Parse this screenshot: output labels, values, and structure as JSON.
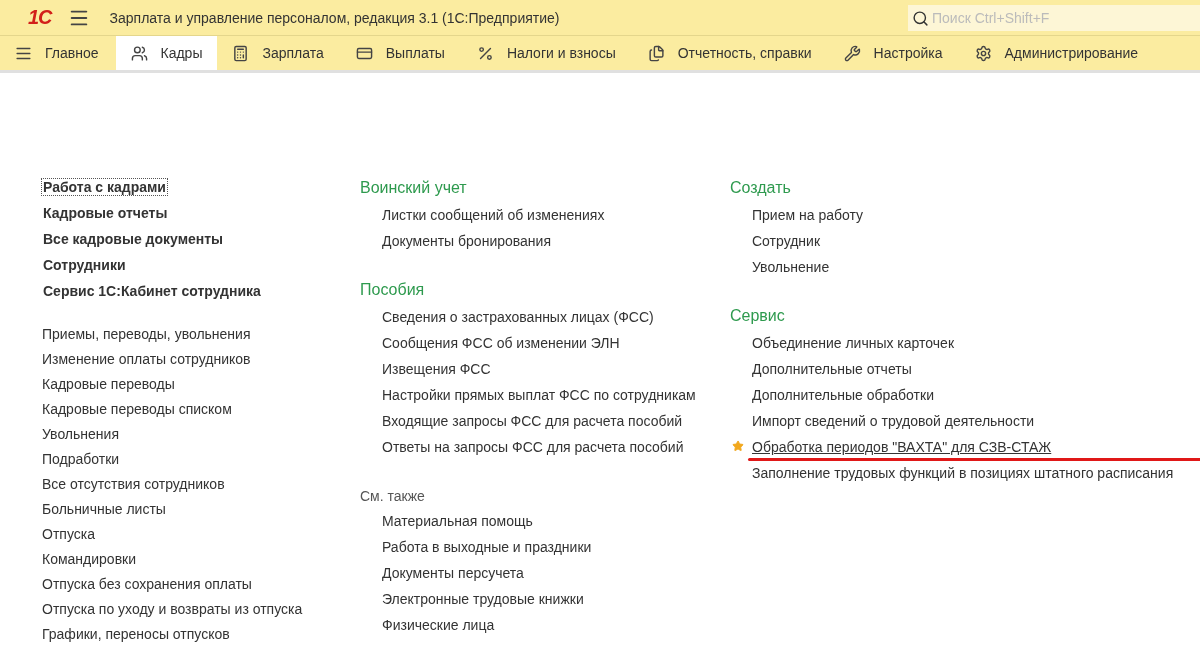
{
  "header": {
    "logo": "1С",
    "title": "Зарплата и управление персоналом, редакция 3.1  (1С:Предприятие)"
  },
  "search": {
    "placeholder": "Поиск Ctrl+Shift+F"
  },
  "sections": [
    {
      "label": "Главное",
      "selected": false
    },
    {
      "label": "Кадры",
      "selected": true
    },
    {
      "label": "Зарплата",
      "selected": false
    },
    {
      "label": "Выплаты",
      "selected": false
    },
    {
      "label": "Налоги и взносы",
      "selected": false
    },
    {
      "label": "Отчетность, справки",
      "selected": false
    },
    {
      "label": "Настройка",
      "selected": false
    },
    {
      "label": "Администрирование",
      "selected": false
    }
  ],
  "left": {
    "primary": [
      {
        "label": "Работа с кадрами",
        "focused": true
      },
      {
        "label": "Кадровые отчеты",
        "focused": false
      },
      {
        "label": "Все кадровые документы",
        "focused": false
      },
      {
        "label": "Сотрудники",
        "focused": false
      },
      {
        "label": "Сервис 1С:Кабинет сотрудника",
        "focused": false
      }
    ],
    "secondary": [
      "Приемы, переводы, увольнения",
      "Изменение оплаты сотрудников",
      "Кадровые переводы",
      "Кадровые переводы списком",
      "Увольнения",
      "Подработки",
      "Все отсутствия сотрудников",
      "Больничные листы",
      "Отпуска",
      "Командировки",
      "Отпуска без сохранения оплаты",
      "Отпуска по уходу и возвраты из отпуска",
      "Графики, переносы отпусков"
    ]
  },
  "columns": [
    {
      "groups": [
        {
          "kind": "heading",
          "title": "Воинский учет",
          "items": [
            {
              "label": "Листки сообщений об изменениях",
              "favorite": false,
              "marked": false
            },
            {
              "label": "Документы бронирования",
              "favorite": false,
              "marked": false
            }
          ]
        },
        {
          "kind": "heading",
          "title": "Пособия",
          "items": [
            {
              "label": "Сведения о застрахованных лицах (ФСС)",
              "favorite": false,
              "marked": false
            },
            {
              "label": "Сообщения ФСС об изменении ЭЛН",
              "favorite": false,
              "marked": false
            },
            {
              "label": "Извещения ФСС",
              "favorite": false,
              "marked": false
            },
            {
              "label": "Настройки прямых выплат ФСС по сотрудникам",
              "favorite": false,
              "marked": false
            },
            {
              "label": "Входящие запросы ФСС для расчета пособий",
              "favorite": false,
              "marked": false
            },
            {
              "label": "Ответы на запросы ФСС для расчета пособий",
              "favorite": false,
              "marked": false
            }
          ]
        },
        {
          "kind": "see_also",
          "title": "См. также",
          "items": [
            {
              "label": "Материальная помощь",
              "favorite": false,
              "marked": false
            },
            {
              "label": "Работа в выходные и праздники",
              "favorite": false,
              "marked": false
            },
            {
              "label": "Документы персучета",
              "favorite": false,
              "marked": false
            },
            {
              "label": "Электронные трудовые книжки",
              "favorite": false,
              "marked": false
            },
            {
              "label": "Физические лица",
              "favorite": false,
              "marked": false
            }
          ]
        }
      ]
    },
    {
      "groups": [
        {
          "kind": "heading",
          "title": "Создать",
          "items": [
            {
              "label": "Прием на работу",
              "favorite": false,
              "marked": false
            },
            {
              "label": "Сотрудник",
              "favorite": false,
              "marked": false
            },
            {
              "label": "Увольнение",
              "favorite": false,
              "marked": false
            }
          ]
        },
        {
          "kind": "heading",
          "title": "Сервис",
          "items": [
            {
              "label": "Объединение личных карточек",
              "favorite": false,
              "marked": false
            },
            {
              "label": "Дополнительные отчеты",
              "favorite": false,
              "marked": false
            },
            {
              "label": "Дополнительные обработки",
              "favorite": false,
              "marked": false
            },
            {
              "label": "Импорт сведений о трудовой деятельности",
              "favorite": false,
              "marked": false
            },
            {
              "label": "Обработка периодов  \"ВАХТА\" для СЗВ-СТАЖ",
              "favorite": true,
              "marked": true
            },
            {
              "label": "Заполнение трудовых функций в позициях штатного расписания",
              "favorite": false,
              "marked": false
            }
          ]
        }
      ]
    }
  ]
}
